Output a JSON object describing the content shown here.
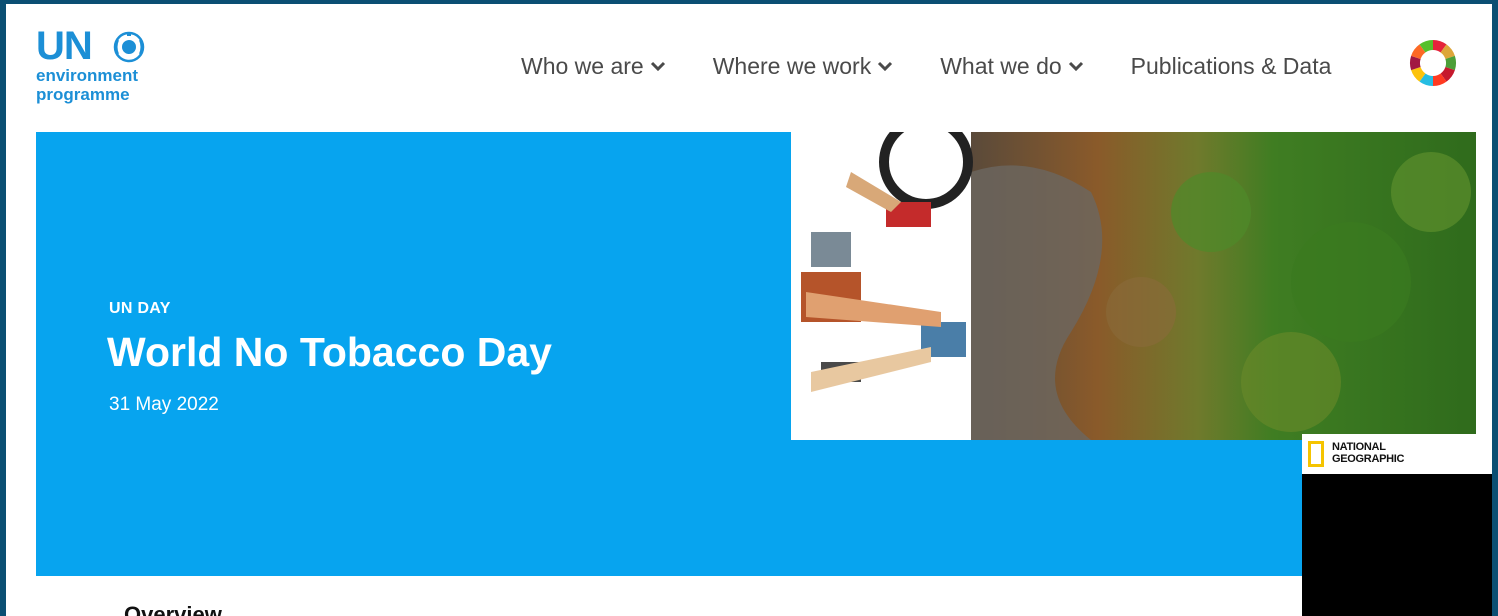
{
  "brand": {
    "logo_un": "UN",
    "logo_line1": "environment",
    "logo_line2": "programme",
    "emblem_icon": "un-emblem-icon",
    "accent": "#1c8fd6"
  },
  "nav": {
    "items": [
      {
        "label": "Who we are",
        "has_dropdown": true
      },
      {
        "label": "Where we work",
        "has_dropdown": true
      },
      {
        "label": "What we do",
        "has_dropdown": true
      },
      {
        "label": "Publications & Data",
        "has_dropdown": false
      }
    ],
    "sdg_icon": "sdg-wheel-icon"
  },
  "hero": {
    "tag": "UN DAY",
    "title": "World No Tobacco Day",
    "date": "31 May 2022",
    "background": "#07a4ef"
  },
  "sponsor": {
    "line1": "NATIONAL",
    "line2": "GEOGRAPHIC"
  },
  "section": {
    "overview": "Overview"
  }
}
